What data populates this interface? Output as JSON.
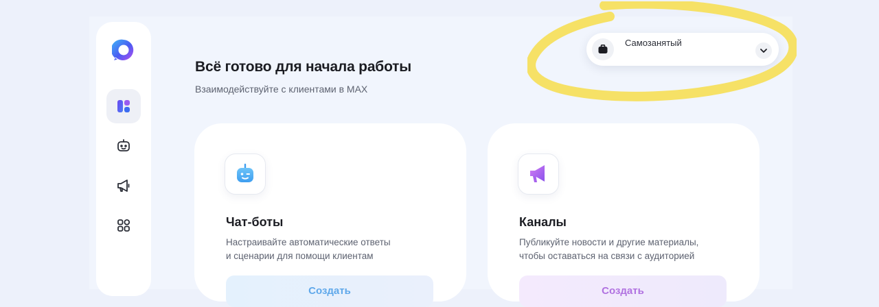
{
  "header": {
    "title": "Всё готово для начала работы",
    "subtitle": "Взаимодействуйте с клиентами в MAX"
  },
  "sidebar": {
    "logo": "max-logo",
    "items": [
      {
        "name": "dashboard",
        "icon": "dashboard-icon",
        "active": true
      },
      {
        "name": "chatbots",
        "icon": "robot-icon",
        "active": false
      },
      {
        "name": "channels",
        "icon": "megaphone-icon",
        "active": false
      },
      {
        "name": "apps",
        "icon": "apps-grid-icon",
        "active": false
      }
    ]
  },
  "status_select": {
    "icon": "briefcase-icon",
    "value": "Самозанятый"
  },
  "cards": [
    {
      "icon": "chatbot-icon",
      "title": "Чат-боты",
      "desc_line1": "Настраивайте автоматические ответы",
      "desc_line2": "и сценарии для помощи клиентам",
      "button": "Создать"
    },
    {
      "icon": "channel-megaphone-icon",
      "title": "Каналы",
      "desc_line1": "Публикуйте новости и другие материалы,",
      "desc_line2": "чтобы оставаться на связи с аудиторией",
      "button": "Создать"
    }
  ],
  "colors": {
    "background": "#edf1fb",
    "highlight": "#f6df55",
    "blue_accent": "#5fa8ea",
    "purple_accent": "#b071e0"
  }
}
